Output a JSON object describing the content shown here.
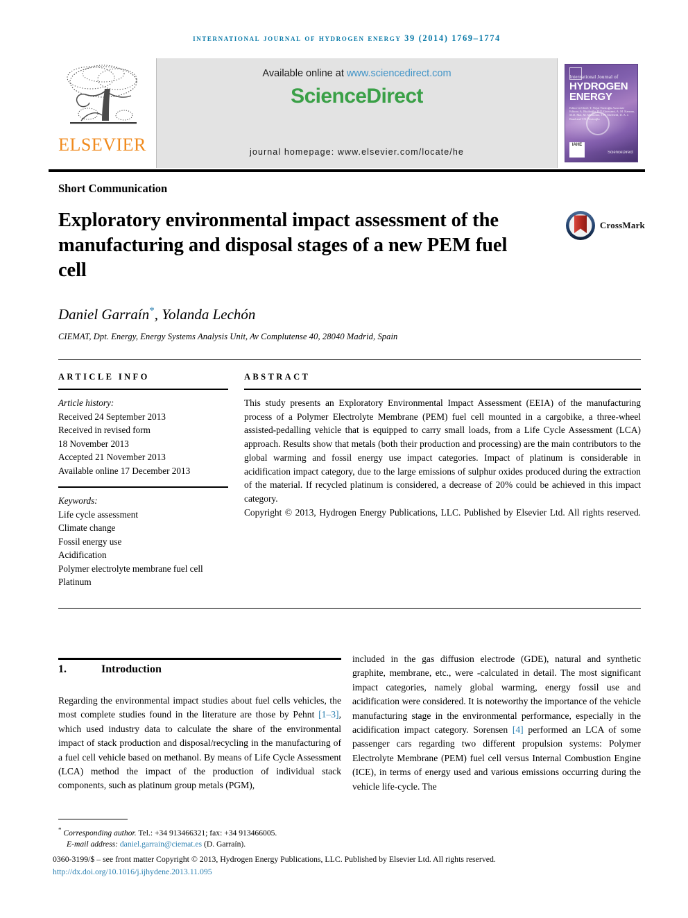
{
  "running_head": "International Journal of Hydrogen Energy 39 (2014) 1769–1774",
  "masthead": {
    "publisher_name": "ELSEVIER",
    "available_prefix": "Available online at ",
    "available_url": "www.sciencedirect.com",
    "sciencedirect_part1": "Science",
    "sciencedirect_part2": "Direct",
    "journal_homepage": "journal homepage: www.elsevier.com/locate/he",
    "cover": {
      "line_small": "International Journal of",
      "line_big1": "HYDROGEN",
      "line_big2": "ENERGY",
      "editors": "Editor-in-Chief: T. Nejat Veziroğlu   Associate Editors: A. Biyikoğlu, D.Y. Goswami, A. M. Kannan, M.D. Mat, M. Momirlan, J.W. Sheffield, D. A. J. Rand and T.N. Veziroğlu",
      "imprint": "IAHE",
      "sd_mark": "ScienceDirect"
    }
  },
  "article": {
    "kind": "Short Communication",
    "title": "Exploratory environmental impact assessment of the manufacturing and disposal stages of a new PEM fuel cell",
    "crossmark_label": "CrossMark",
    "authors": "Daniel Garraín",
    "authors_star": "*",
    "authors_rest": ", Yolanda Lechón",
    "affiliation": "CIEMAT, Dpt. Energy, Energy Systems Analysis Unit, Av Complutense 40, 28040 Madrid, Spain"
  },
  "article_info": {
    "heading": "ARTICLE INFO",
    "history_label": "Article history:",
    "history": [
      "Received 24 September 2013",
      "Received in revised form",
      "18 November 2013",
      "Accepted 21 November 2013",
      "Available online 17 December 2013"
    ],
    "keywords_label": "Keywords:",
    "keywords": [
      "Life cycle assessment",
      "Climate change",
      "Fossil energy use",
      "Acidification",
      "Polymer electrolyte membrane fuel cell",
      "Platinum"
    ]
  },
  "abstract": {
    "heading": "ABSTRACT",
    "body": "This study presents an Exploratory Environmental Impact Assessment (EEIA) of the manufacturing process of a Polymer Electrolyte Membrane (PEM) fuel cell mounted in a cargobike, a three-wheel assisted-pedalling vehicle that is equipped to carry small loads, from a Life Cycle Assessment (LCA) approach. Results show that metals (both their production and processing) are the main contributors to the global warming and fossil energy use impact categories. Impact of platinum is considerable in acidification impact category, due to the large emissions of sulphur oxides produced during the extraction of the material. If recycled platinum is considered, a decrease of 20% could be achieved in this impact category.",
    "copyright": "Copyright © 2013, Hydrogen Energy Publications, LLC. Published by Elsevier Ltd. All rights reserved."
  },
  "section": {
    "number": "1.",
    "name": "Introduction"
  },
  "body": {
    "left_col": "Regarding the environmental impact studies about fuel cells vehicles, the most complete studies found in the literature are those by Pehnt ",
    "left_ref": "[1–3]",
    "left_col_2": ", which used industry data to calculate the share of the environmental impact of stack production and disposal/recycling in the manufacturing of a fuel cell vehicle based on methanol. By means of Life Cycle Assessment (LCA) method the impact of the production of individual stack components, such as platinum group metals (PGM),",
    "right_col": "included in the gas diffusion electrode (GDE), natural and synthetic graphite, membrane, etc., were -calculated in detail. The most significant impact categories, namely global warming, energy fossil use and acidification were considered. It is noteworthy the importance of the vehicle manufacturing stage in the environmental performance, especially in the acidification impact category. Sorensen ",
    "right_ref": "[4]",
    "right_col_2": " performed an LCA of some passenger cars regarding two different propulsion systems: Polymer Electrolyte Membrane (PEM) fuel cell versus Internal Combustion Engine (ICE), in terms of energy used and various emissions occurring during the vehicle life-cycle. The"
  },
  "footer": {
    "star": "*",
    "corresponding_label": "Corresponding author.",
    "corresponding_rest": " Tel.: +34 913466321; fax: +34 913466005.",
    "email_label": "E-mail address:",
    "email": "daniel.garrain@ciemat.es",
    "email_suffix": " (D. Garraín).",
    "issn_line": "0360-3199/$ – see front matter Copyright © 2013, Hydrogen Energy Publications, LLC. Published by Elsevier Ltd. All rights reserved.",
    "doi": "http://dx.doi.org/10.1016/j.ijhydene.2013.11.095"
  },
  "colors": {
    "journal_blue": "#0a7aa8",
    "link_blue": "#2a7fb0",
    "sciencedirect_green": "#3aa047",
    "elsevier_orange": "#f08a1d",
    "crossmark_blue": "#1f3f6b",
    "crossmark_red": "#c02b26"
  }
}
